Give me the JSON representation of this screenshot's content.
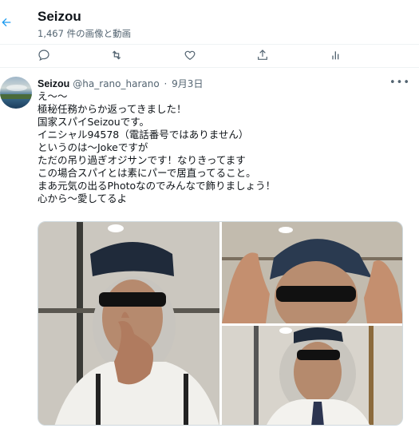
{
  "header": {
    "title": "Seizou",
    "subtitle": "1,467 件の画像と動画",
    "back_icon": "arrow-left-icon"
  },
  "top_actions": [
    {
      "icon": "reply-icon"
    },
    {
      "icon": "retweet-icon"
    },
    {
      "icon": "like-icon"
    },
    {
      "icon": "share-icon"
    },
    {
      "icon": "analytics-icon"
    }
  ],
  "tweet": {
    "name": "Seizou",
    "handle": "@ha_rano_harano",
    "separator": "·",
    "date": "9月3日",
    "more": "•••",
    "lines": [
      "え～～",
      "極秘任務からか返ってきました！",
      "国家スパイSeizouです。",
      "イニシャル94578（電話番号ではありません）",
      "というのは～Jokeですが",
      "ただの吊り過ぎオジサンです！なりきってます",
      "この場合スパイとは素にパーで居直ってること。",
      "まあ元気の出るPhotoなのでみんなで飾りましょう！",
      "心から～愛してるよ"
    ]
  },
  "colors": {
    "accent": "#1d9bf0",
    "muted": "#536471",
    "border": "#eff3f4"
  }
}
